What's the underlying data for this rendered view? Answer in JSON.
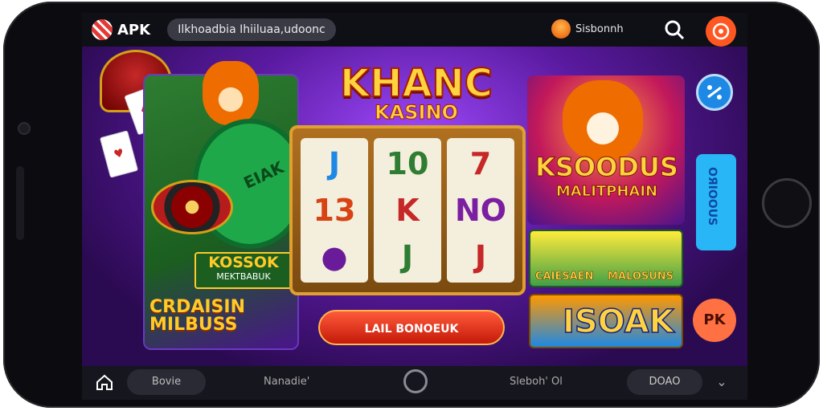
{
  "status_bar": {
    "brand": "APK",
    "url": "Ilkhoadbia Ihiiluaa,udoonc",
    "account": "Sisbonnh"
  },
  "title": {
    "line1": "KHANC",
    "line2": "KASINO"
  },
  "left_card": {
    "table_text": "EIAK",
    "label_main": "KOSSOK",
    "label_sub": "MEKTBABUK",
    "footer_line1": "CRDAISIN",
    "footer_line2": "MILBUSS"
  },
  "slot": {
    "reels": [
      [
        "J",
        "13",
        "●"
      ],
      [
        "10",
        "K",
        "J"
      ],
      [
        "7",
        "NO",
        "J"
      ]
    ]
  },
  "spin_button": "LAIL BONOEUK",
  "right_card": {
    "title": "KSOODUS",
    "subtitle": "MALITPHAIN"
  },
  "right_middle": {
    "left_label": "CAIESAEN",
    "right_label": "MALOSUNS"
  },
  "right_bottom": {
    "label": "ISOAK"
  },
  "side": {
    "tall_label": "ОЯIOOUS",
    "round_label": "PK"
  },
  "nav": {
    "pill1": "Bovie",
    "item2": "Nanadie'",
    "item3": "Sleboh' Ol",
    "pill2_label": "DOAO"
  },
  "colors": {
    "accent": "#ff5722",
    "brand_gold": "#ffd23f",
    "screen_bg": "#2a0c4a"
  },
  "icons": [
    "home-icon",
    "search-icon",
    "menu-icon",
    "chevron-down-icon",
    "settings-icon"
  ]
}
